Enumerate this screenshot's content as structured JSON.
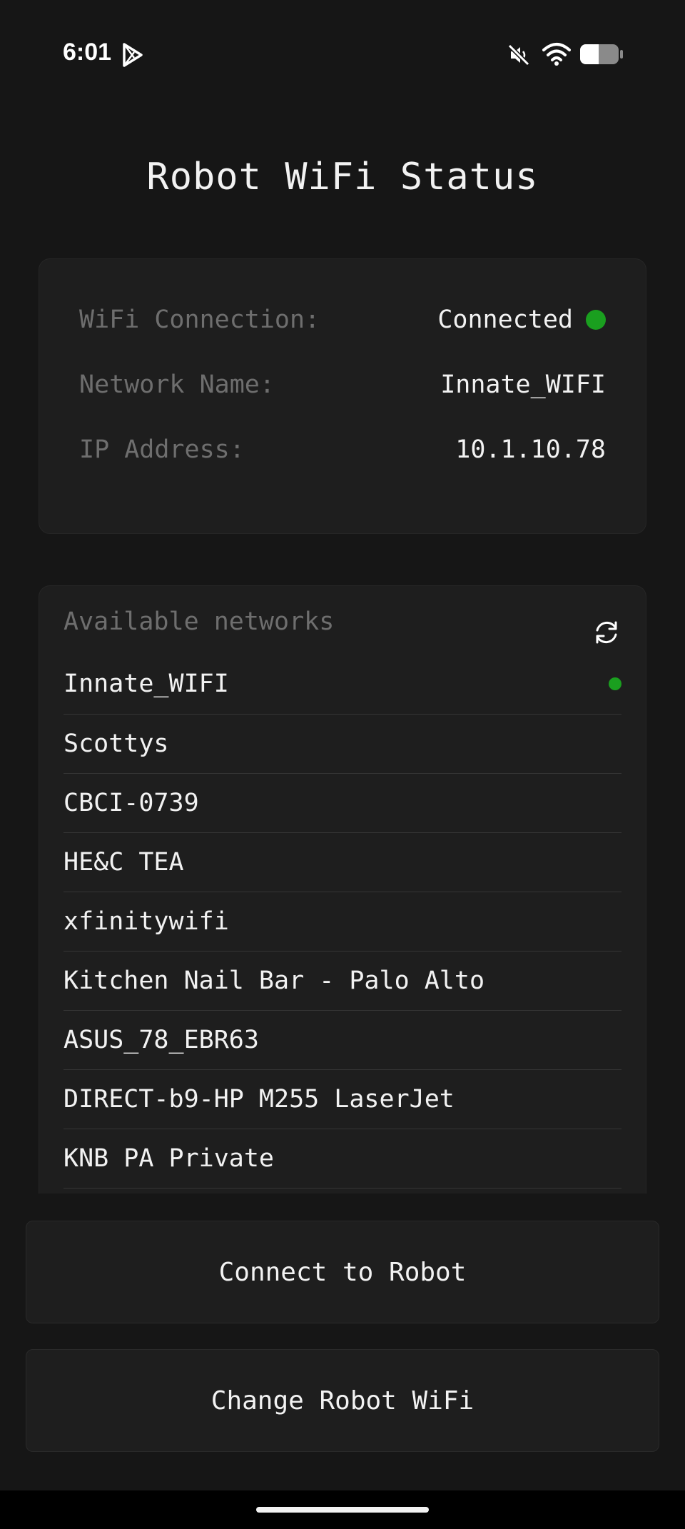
{
  "status_bar": {
    "time": "6:01",
    "icons": [
      "play-store-icon",
      "mute-icon",
      "wifi-icon",
      "battery-icon"
    ]
  },
  "title": "Robot WiFi Status",
  "status": {
    "wifi_connection_label": "WiFi Connection:",
    "wifi_connection_value": "Connected",
    "network_name_label": "Network Name:",
    "network_name_value": "Innate_WIFI",
    "ip_address_label": "IP Address:",
    "ip_address_value": "10.1.10.78"
  },
  "networks": {
    "header": "Available networks",
    "refresh_icon": "refresh-icon",
    "items": [
      {
        "name": "Innate_WIFI",
        "connected": true
      },
      {
        "name": "Scottys",
        "connected": false
      },
      {
        "name": "CBCI-0739",
        "connected": false
      },
      {
        "name": "HE&C TEA",
        "connected": false
      },
      {
        "name": "xfinitywifi",
        "connected": false
      },
      {
        "name": "Kitchen Nail Bar - Palo Alto",
        "connected": false
      },
      {
        "name": "ASUS_78_EBR63",
        "connected": false
      },
      {
        "name": "DIRECT-b9-HP M255 LaserJet",
        "connected": false
      },
      {
        "name": "KNB PA Private",
        "connected": false
      }
    ]
  },
  "buttons": {
    "connect": "Connect to Robot",
    "change_wifi": "Change Robot WiFi"
  },
  "colors": {
    "background": "#161616",
    "card": "#1e1e1e",
    "connected_dot": "#1a9f1f",
    "label": "#6e6e6e",
    "text": "#f2f2f2"
  }
}
